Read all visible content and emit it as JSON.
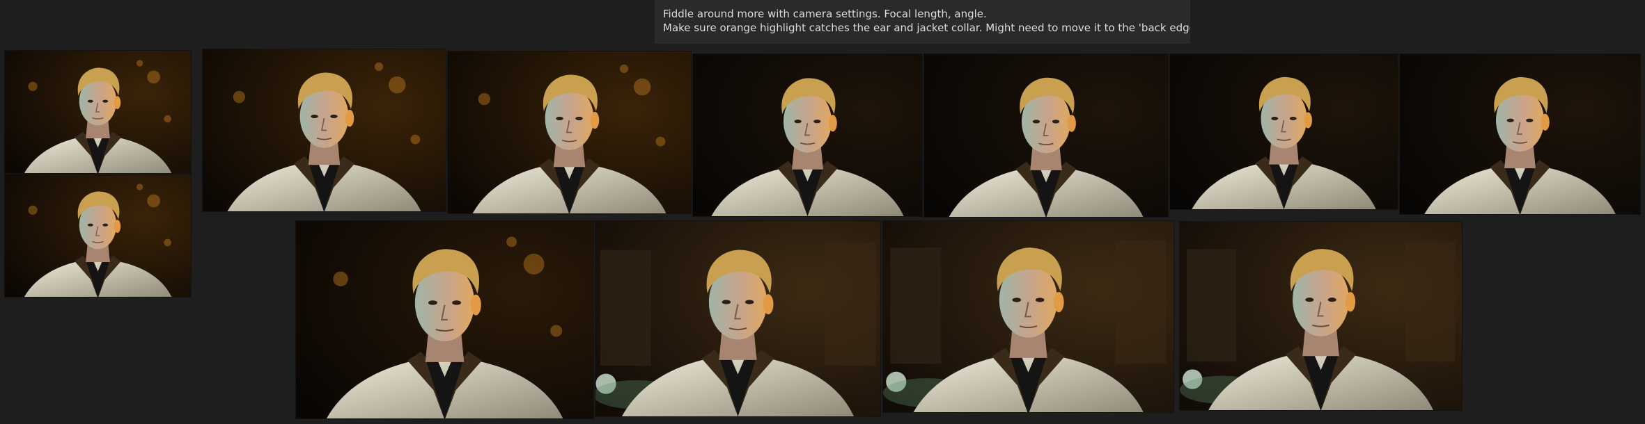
{
  "note": {
    "line1": "Fiddle around more with camera settings. Focal length, angle.",
    "line2": "Make sure orange highlight catches the ear and jacket collar. Might need to move it to the 'back edge'??"
  },
  "frames": [
    {
      "name": "render-thumb-1",
      "bg": "dark-amber",
      "icon": "portrait-render"
    },
    {
      "name": "render-thumb-2",
      "bg": "dark-amber-bokeh",
      "icon": "portrait-render"
    },
    {
      "name": "render-01",
      "bg": "amber-bokeh",
      "icon": "portrait-render"
    },
    {
      "name": "render-02",
      "bg": "amber-bokeh",
      "icon": "portrait-render"
    },
    {
      "name": "render-03",
      "bg": "dark",
      "icon": "portrait-render"
    },
    {
      "name": "render-04",
      "bg": "dark",
      "icon": "portrait-render"
    },
    {
      "name": "render-05",
      "bg": "dark",
      "icon": "portrait-render"
    },
    {
      "name": "render-06",
      "bg": "dark",
      "icon": "portrait-render"
    },
    {
      "name": "render-07",
      "bg": "dark-bokeh",
      "icon": "portrait-render"
    },
    {
      "name": "render-08",
      "bg": "street-green",
      "icon": "portrait-render"
    },
    {
      "name": "render-09",
      "bg": "street-green",
      "icon": "portrait-render"
    },
    {
      "name": "render-10",
      "bg": "street-green",
      "icon": "portrait-render"
    }
  ],
  "colors": {
    "canvas": "#1e1e1e",
    "note_bg": "#2a2a2a",
    "note_text": "#dcdcdc",
    "hair": "#c9a050",
    "skin": "#c9a48b",
    "jacket": "#d9d4c4",
    "shirt": "#141414",
    "amber": "#c27a1e",
    "green": "#5f8f6e"
  }
}
